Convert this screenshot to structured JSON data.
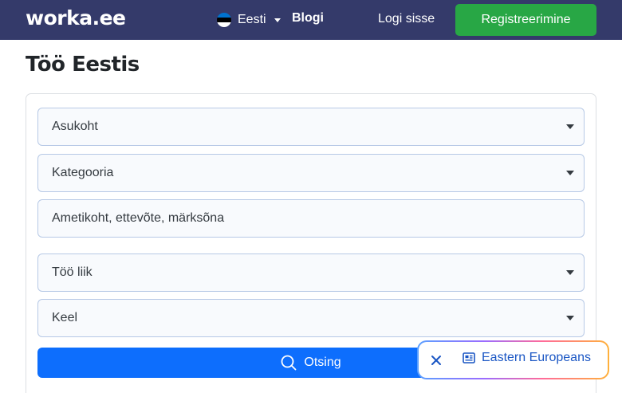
{
  "navbar": {
    "logo": "worka.ee",
    "language": "Eesti",
    "blog_label": "Blogi",
    "login_label": "Logi sisse",
    "register_label": "Registreerimine",
    "colors": {
      "background": "#343a6a",
      "register": "#28a745"
    }
  },
  "page": {
    "title": "Töö Eestis"
  },
  "search_form": {
    "location_placeholder": "Asukoht",
    "category_placeholder": "Kategooria",
    "keyword_placeholder": "Ametikoht, ettevõte, märksõna",
    "job_type_placeholder": "Töö liik",
    "language_placeholder": "Keel",
    "search_label": "Otsing",
    "search_color": "#0d6efd"
  },
  "widget": {
    "label": "Eastern Europeans"
  }
}
